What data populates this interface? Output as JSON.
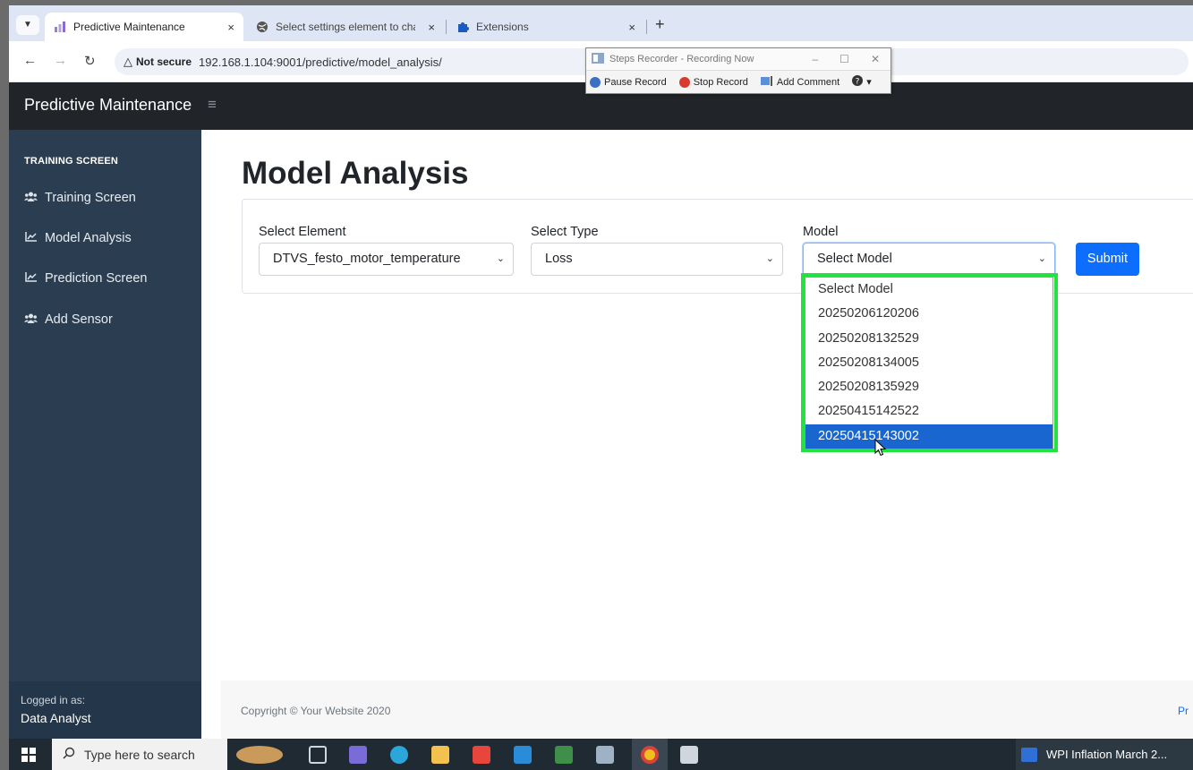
{
  "browser": {
    "tabs": [
      {
        "title": "Predictive Maintenance",
        "icon": "chart-favicon-icon",
        "active": true
      },
      {
        "title": "Select settings element to char",
        "icon": "globe-icon",
        "active": false
      },
      {
        "title": "Extensions",
        "icon": "puzzle-icon",
        "active": false
      }
    ],
    "close_glyph": "×",
    "new_tab_glyph": "+",
    "security_label": "Not secure",
    "url": "192.168.1.104:9001/predictive/model_analysis/"
  },
  "recorder": {
    "title": "Steps Recorder - Recording Now",
    "pause_label": "Pause Record",
    "stop_label": "Stop Record",
    "comment_label": "Add Comment",
    "pause_color": "#3a6fc4",
    "stop_color": "#d83b2d"
  },
  "app": {
    "brand": "Predictive Maintenance",
    "hamburger_glyph": "≡"
  },
  "sidebar": {
    "heading": "TRAINING SCREEN",
    "items": [
      {
        "label": "Training Screen",
        "icon": "users-icon",
        "glyph": "👥"
      },
      {
        "label": "Model Analysis",
        "icon": "chart-line-icon",
        "glyph": "📈"
      },
      {
        "label": "Prediction Screen",
        "icon": "chart-line-icon",
        "glyph": "📈"
      },
      {
        "label": "Add Sensor",
        "icon": "users-icon",
        "glyph": "👥"
      }
    ],
    "logged_in_label": "Logged in as:",
    "logged_in_user": "Data Analyst"
  },
  "main": {
    "title": "Model Analysis",
    "element_label": "Select Element",
    "element_value": "DTVS_festo_motor_temperature",
    "type_label": "Select Type",
    "type_value": "Loss",
    "model_label": "Model",
    "model_value": "Select Model",
    "submit_label": "Submit",
    "model_options": [
      "Select Model",
      "20250206120206",
      "20250208132529",
      "20250208134005",
      "20250208135929",
      "20250415142522",
      "20250415143002"
    ],
    "highlighted_option": "20250415143002",
    "highlight_color": "#22e33d"
  },
  "footer": {
    "copyright": "Copyright © Your Website 2020",
    "right_text": "Pr"
  },
  "taskbar": {
    "search_placeholder": "Type here to search",
    "running_app": "WPI Inflation March 2..."
  }
}
